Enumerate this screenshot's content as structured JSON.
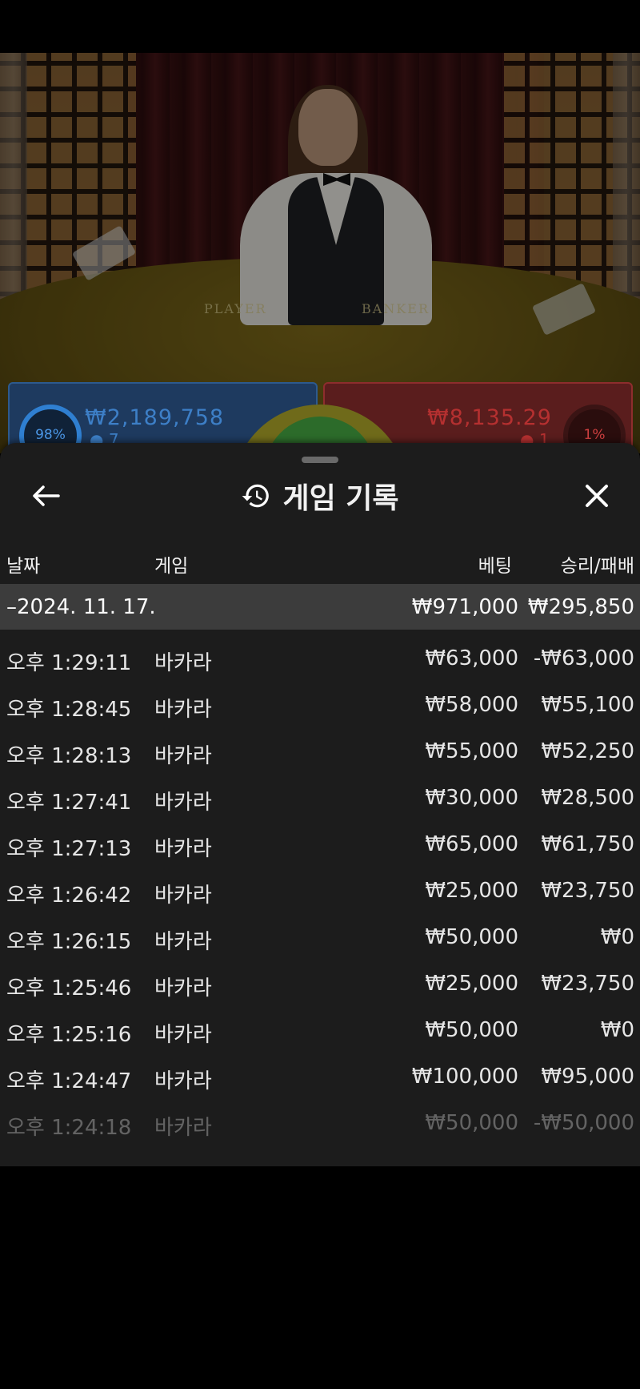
{
  "video": {
    "felt_player_label": "PLAYER",
    "felt_banker_label": "BANKER"
  },
  "bet_spots": {
    "player": {
      "percent": "98%",
      "amount": "₩2,189,758",
      "count": "7",
      "color": "#2f7fd1"
    },
    "banker": {
      "percent": "1%",
      "amount": "₩8,135.29",
      "count": "1",
      "color": "#d04040"
    }
  },
  "panel": {
    "title": "게임 기록",
    "back_icon": "arrow-left-icon",
    "history_icon": "history-icon",
    "close_icon": "close-icon",
    "columns": {
      "date": "날짜",
      "game": "게임",
      "bet": "베팅",
      "win_loss": "승리/패배"
    },
    "summary": {
      "date": "–2024. 11. 17.",
      "bet": "₩971,000",
      "win_loss": "₩295,850"
    },
    "rows": [
      {
        "time": "오후 1:29:11",
        "game": "바카라",
        "bet": "₩63,000",
        "result": "-₩63,000"
      },
      {
        "time": "오후 1:28:45",
        "game": "바카라",
        "bet": "₩58,000",
        "result": "₩55,100"
      },
      {
        "time": "오후 1:28:13",
        "game": "바카라",
        "bet": "₩55,000",
        "result": "₩52,250"
      },
      {
        "time": "오후 1:27:41",
        "game": "바카라",
        "bet": "₩30,000",
        "result": "₩28,500"
      },
      {
        "time": "오후 1:27:13",
        "game": "바카라",
        "bet": "₩65,000",
        "result": "₩61,750"
      },
      {
        "time": "오후 1:26:42",
        "game": "바카라",
        "bet": "₩25,000",
        "result": "₩23,750"
      },
      {
        "time": "오후 1:26:15",
        "game": "바카라",
        "bet": "₩50,000",
        "result": "₩0"
      },
      {
        "time": "오후 1:25:46",
        "game": "바카라",
        "bet": "₩25,000",
        "result": "₩23,750"
      },
      {
        "time": "오후 1:25:16",
        "game": "바카라",
        "bet": "₩50,000",
        "result": "₩0"
      },
      {
        "time": "오후 1:24:47",
        "game": "바카라",
        "bet": "₩100,000",
        "result": "₩95,000"
      },
      {
        "time": "오후 1:24:18",
        "game": "바카라",
        "bet": "₩50,000",
        "result": "-₩50,000"
      }
    ]
  }
}
